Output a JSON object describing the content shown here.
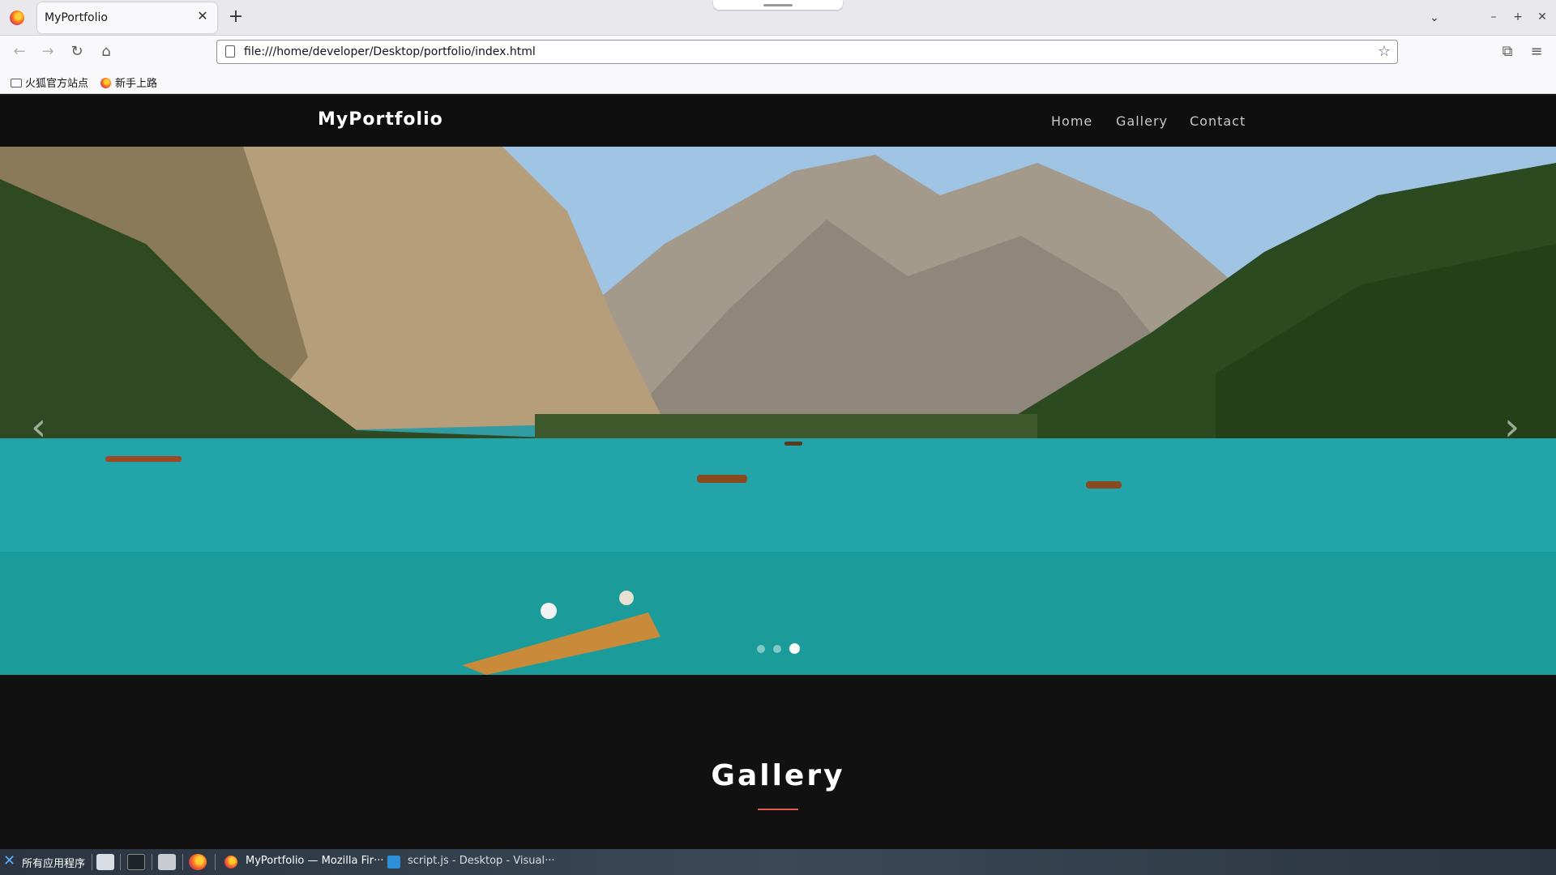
{
  "browser": {
    "tab_title": "MyPortfolio",
    "url": "file:///home/developer/Desktop/portfolio/index.html",
    "bookmarks": [
      {
        "label": "火狐官方站点",
        "icon": "folder-icon"
      },
      {
        "label": "新手上路",
        "icon": "firefox-icon"
      }
    ],
    "icons": {
      "back": "arrow-left-icon",
      "forward": "arrow-right-icon",
      "reload": "reload-icon",
      "home": "home-icon",
      "bookmark": "star-icon",
      "extensions": "puzzle-icon",
      "menu": "hamburger-icon"
    }
  },
  "site": {
    "brand": "MyPortfolio",
    "nav": [
      "Home",
      "Gallery",
      "Contact"
    ],
    "carousel": {
      "slides": 3,
      "active_index": 2,
      "prev_icon": "chevron-left-icon",
      "next_icon": "chevron-right-icon"
    },
    "section_title": "Gallery",
    "accent_color": "#e05a4f"
  },
  "taskbar": {
    "start_label": "所有应用程序",
    "windows": [
      {
        "label": "MyPortfolio — Mozilla Fir···",
        "icon": "firefox-icon"
      },
      {
        "label": "script.js - Desktop - Visual···",
        "icon": "vscode-icon"
      }
    ]
  }
}
